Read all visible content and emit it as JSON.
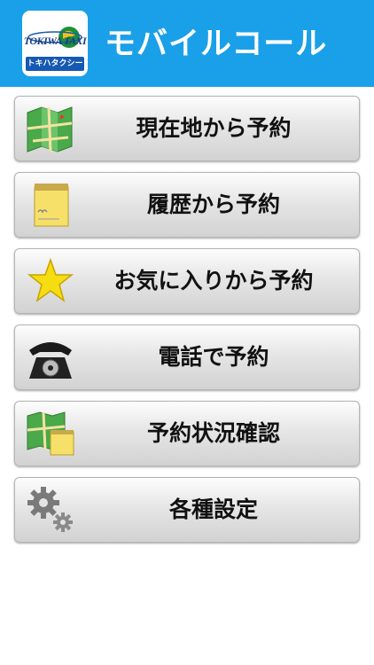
{
  "header": {
    "app_title": "モバイルコール",
    "logo": {
      "brand_text": "TOKIWA TAXI",
      "sub_text": "トキハタクシー"
    },
    "color": "#1aa0e8"
  },
  "menu": {
    "items": [
      {
        "label": "現在地から予約",
        "icon": "map-icon"
      },
      {
        "label": "履歴から予約",
        "icon": "memo-pad-icon"
      },
      {
        "label": "お気に入りから予約",
        "icon": "star-icon"
      },
      {
        "label": "電話で予約",
        "icon": "rotary-phone-icon"
      },
      {
        "label": "予約状況確認",
        "icon": "map-with-memo-icon"
      },
      {
        "label": "各種設定",
        "icon": "gears-icon"
      }
    ]
  }
}
